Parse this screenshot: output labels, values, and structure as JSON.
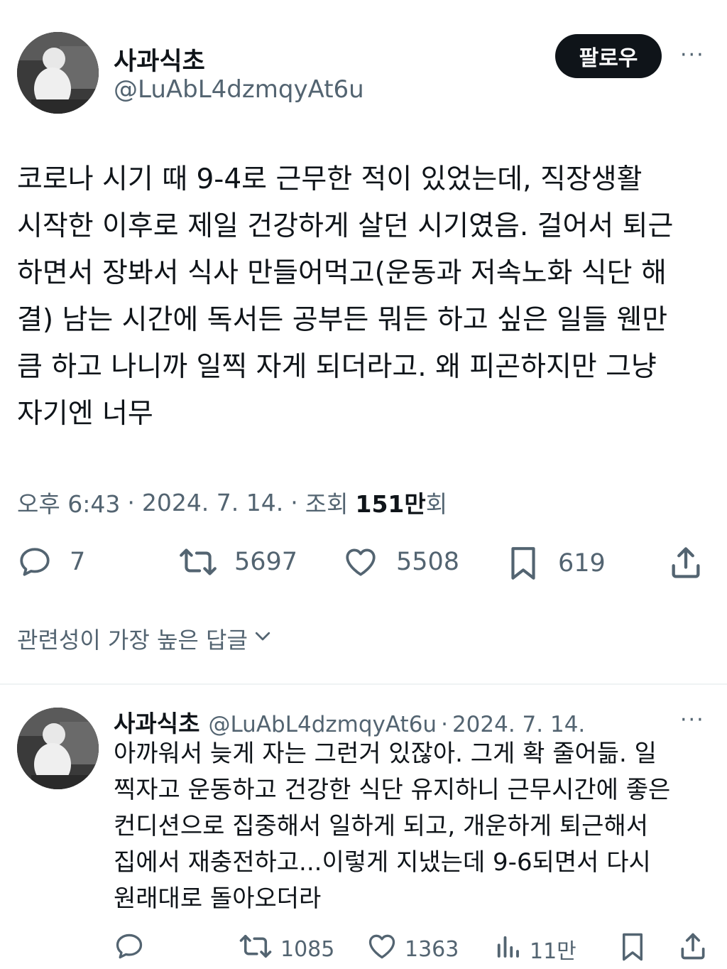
{
  "tweet": {
    "author_name": "사과식초",
    "author_handle": "@LuAbL4dzmqyAt6u",
    "follow_label": "팔로우",
    "more_label": "···",
    "text": "코로나 시기 때 9-4로 근무한 적이 있었는데, 직장생활\n시작한 이후로 제일 건강하게 살던 시기였음. 걸어서 퇴근\n하면서 장봐서 식사 만들어먹고(운동과 저속노화 식단 해\n결) 남는 시간에 독서든 공부든 뭐든 하고 싶은 일들 웬만\n큼 하고 나니까 일찍 자게 되더라고. 왜 피곤하지만 그냥\n자기엔 너무",
    "time": "오후 6:43",
    "dot1": "·",
    "date": "2024. 7. 14.",
    "dot2": "·",
    "views_label": "조회",
    "views_value": "151만",
    "views_suffix": "회",
    "actions": {
      "reply_count": "7",
      "retweet_count": "5697",
      "like_count": "5508",
      "bookmark_count": "619"
    },
    "icons": [
      "reply-icon",
      "retweet-icon",
      "heart-icon",
      "bookmark-icon",
      "share-icon"
    ]
  },
  "replies_sort": {
    "label": "관련성이 가장 높은 답글",
    "icon": "chevron-down-icon"
  },
  "reply": {
    "author_name": "사과식초",
    "author_handle": "@LuAbL4dzmqyAt6u",
    "dot": "·",
    "date": "2024. 7. 14.",
    "more_label": "···",
    "text": "아까워서 늦게 자는 그런거 있잖아. 그게 확 줄어듦. 일\n찍자고 운동하고 건강한 식단 유지하니 근무시간에 좋은\n컨디션으로 집중해서 일하게 되고, 개운하게 퇴근해서\n집에서 재충전하고...이렇게 지냈는데 9-6되면서 다시\n원래대로 돌아오더라",
    "actions": {
      "retweet_count": "1085",
      "like_count": "1363",
      "views_count": "11만"
    }
  },
  "colors": {
    "text_primary": "#0f1419",
    "text_secondary": "#536471",
    "follow_bg": "#0f1419",
    "divider": "#eff3f4"
  }
}
